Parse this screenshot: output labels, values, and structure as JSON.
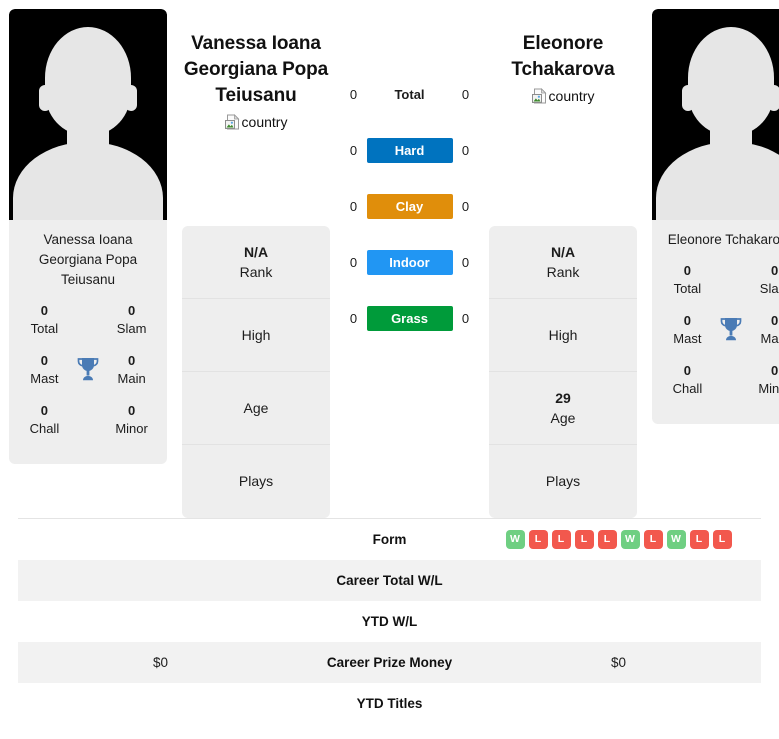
{
  "players": {
    "left": {
      "name": "Vanessa Ioana Georgiana Popa Teiusanu",
      "card_name": "Vanessa Ioana Georgiana Popa Teiusanu",
      "country_alt": "country",
      "trophies": {
        "total": {
          "value": "0",
          "label": "Total"
        },
        "slam": {
          "value": "0",
          "label": "Slam"
        },
        "mast": {
          "value": "0",
          "label": "Mast"
        },
        "main": {
          "value": "0",
          "label": "Main"
        },
        "chall": {
          "value": "0",
          "label": "Chall"
        },
        "minor": {
          "value": "0",
          "label": "Minor"
        }
      },
      "info": {
        "rank": {
          "value": "N/A",
          "label": "Rank"
        },
        "high": {
          "value": "",
          "label": "High"
        },
        "age": {
          "value": "",
          "label": "Age"
        },
        "plays": {
          "value": "",
          "label": "Plays"
        }
      },
      "surface_counts": {
        "total": "0",
        "hard": "0",
        "clay": "0",
        "indoor": "0",
        "grass": "0"
      },
      "form": [],
      "career_total_wl": "",
      "ytd_wl": "",
      "career_prize_money": "$0",
      "ytd_titles": ""
    },
    "right": {
      "name": "Eleonore Tchakarova",
      "card_name": "Eleonore Tchakarova",
      "country_alt": "country",
      "trophies": {
        "total": {
          "value": "0",
          "label": "Total"
        },
        "slam": {
          "value": "0",
          "label": "Slam"
        },
        "mast": {
          "value": "0",
          "label": "Mast"
        },
        "main": {
          "value": "0",
          "label": "Main"
        },
        "chall": {
          "value": "0",
          "label": "Chall"
        },
        "minor": {
          "value": "0",
          "label": "Minor"
        }
      },
      "info": {
        "rank": {
          "value": "N/A",
          "label": "Rank"
        },
        "high": {
          "value": "",
          "label": "High"
        },
        "age": {
          "value": "29",
          "label": "Age"
        },
        "plays": {
          "value": "",
          "label": "Plays"
        }
      },
      "surface_counts": {
        "total": "0",
        "hard": "0",
        "clay": "0",
        "indoor": "0",
        "grass": "0"
      },
      "form": [
        "W",
        "L",
        "L",
        "L",
        "L",
        "W",
        "L",
        "W",
        "L",
        "L"
      ],
      "career_total_wl": "",
      "ytd_wl": "",
      "career_prize_money": "$0",
      "ytd_titles": ""
    }
  },
  "surfaces": [
    {
      "key": "total",
      "label": "Total",
      "color": "transparent",
      "has_bar": false
    },
    {
      "key": "hard",
      "label": "Hard",
      "color": "#0073bf",
      "has_bar": true
    },
    {
      "key": "clay",
      "label": "Clay",
      "color": "#e08e0b",
      "has_bar": true
    },
    {
      "key": "indoor",
      "label": "Indoor",
      "color": "#2196f3",
      "has_bar": true
    },
    {
      "key": "grass",
      "label": "Grass",
      "color": "#009b3a",
      "has_bar": true
    }
  ],
  "table_rows": [
    {
      "label": "Form",
      "key": "form",
      "shade": false,
      "type": "badges"
    },
    {
      "label": "Career Total W/L",
      "key": "career_total_wl",
      "shade": true,
      "type": "text"
    },
    {
      "label": "YTD W/L",
      "key": "ytd_wl",
      "shade": false,
      "type": "text"
    },
    {
      "label": "Career Prize Money",
      "key": "career_prize_money",
      "shade": true,
      "type": "text"
    },
    {
      "label": "YTD Titles",
      "key": "ytd_titles",
      "shade": false,
      "type": "text"
    }
  ],
  "colors": {
    "win_badge": "#6fcf82",
    "loss_badge": "#f2584d",
    "trophy": "#4a7bb5",
    "card_bg": "#eeeeee",
    "row_shade": "#f2f2f2"
  },
  "icons": {
    "trophy": "trophy-icon",
    "broken_image": "broken-image-icon"
  }
}
